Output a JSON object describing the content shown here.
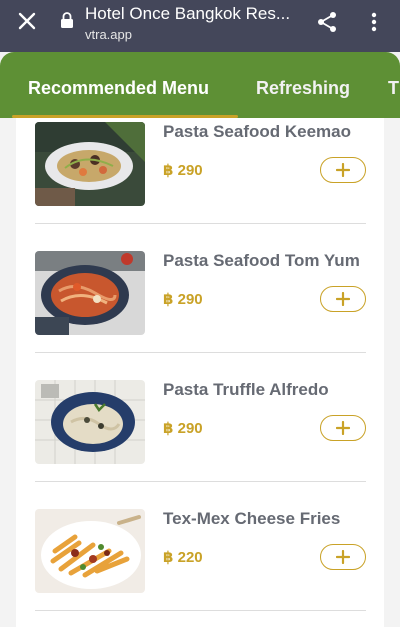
{
  "browser": {
    "title": "Hotel Once Bangkok Res...",
    "url": "vtra.app"
  },
  "tabs": [
    {
      "label": "Recommended Menu",
      "active": true
    },
    {
      "label": "Refreshing",
      "active": false
    },
    {
      "label": "T",
      "active": false
    }
  ],
  "menu_items": [
    {
      "name": "Pasta Seafood Keemao",
      "price": "฿ 290"
    },
    {
      "name": "Pasta Seafood Tom Yum",
      "price": "฿ 290"
    },
    {
      "name": "Pasta Truffle Alfredo",
      "price": "฿ 290"
    },
    {
      "name": "Tex-Mex Cheese Fries",
      "price": "฿ 220"
    }
  ],
  "colors": {
    "chrome_bg": "#44475a",
    "tab_bar_bg": "#5e9035",
    "accent_gold": "#c9a227",
    "item_name": "#666a73"
  }
}
